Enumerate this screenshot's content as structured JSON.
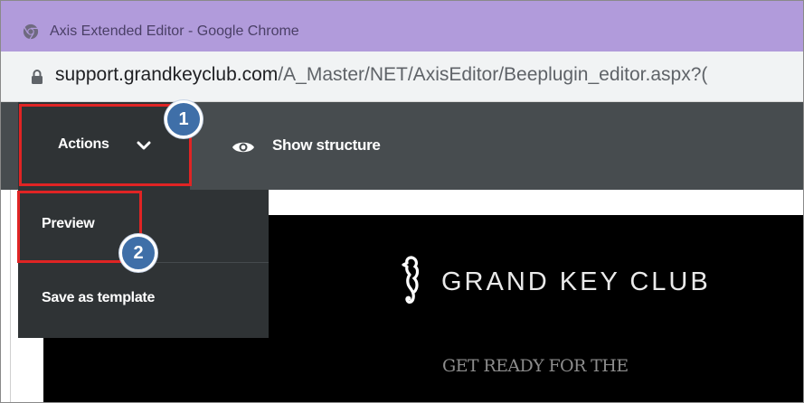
{
  "window": {
    "title": "Axis Extended Editor - Google Chrome"
  },
  "address_bar": {
    "url_host": "support.grandkeyclub.com",
    "url_path": "/A_Master/NET/AxisEditor/Beeplugin_editor.aspx?("
  },
  "toolbar": {
    "actions_label": "Actions",
    "show_structure_label": "Show structure"
  },
  "actions_menu": {
    "items": [
      {
        "label": "Preview"
      },
      {
        "label": "Save as template"
      }
    ]
  },
  "email_preview": {
    "brand_name": "GRAND KEY CLUB",
    "tagline": "GET READY FOR THE"
  },
  "annotations": {
    "step_1": "1",
    "step_2": "2"
  },
  "colors": {
    "titlebar": "#b19bdb",
    "toolbar": "#474c4f",
    "menu": "#2f3335",
    "highlight": "#e02424",
    "badge": "#3f6fa8",
    "email_background": "#000000"
  },
  "icons": {
    "browser": "chrome-logo-icon",
    "security": "lock-icon",
    "actions_dropdown": "chevron-down-icon",
    "show_structure": "eye-icon",
    "brand_logo": "seahorse-logo"
  }
}
